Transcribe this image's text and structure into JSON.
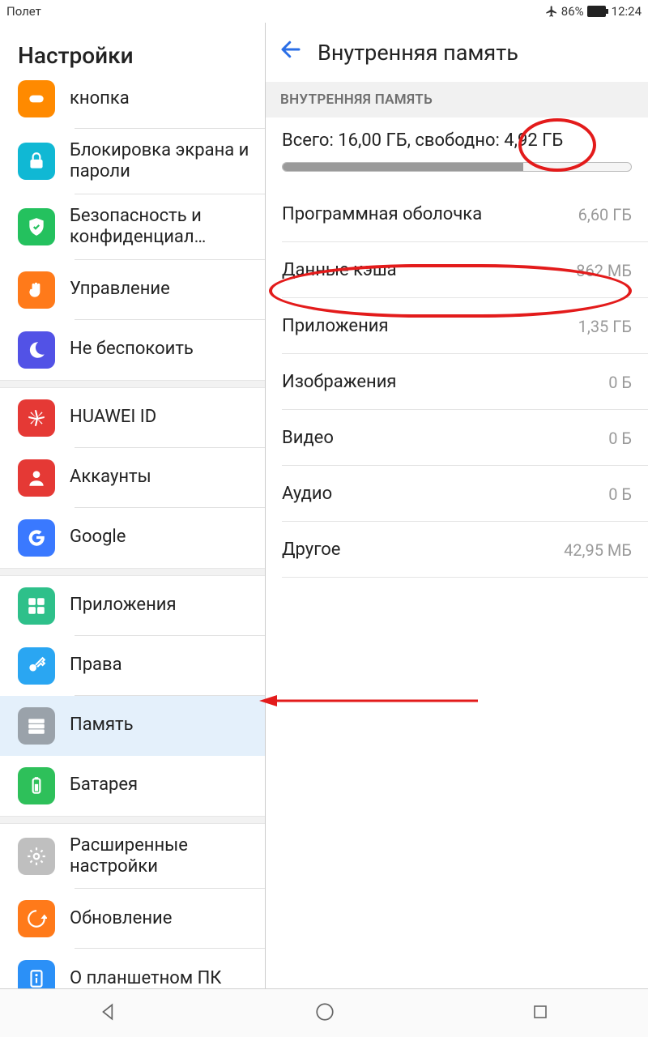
{
  "status": {
    "carrier": "Полет",
    "battery": "86%",
    "time": "12:24"
  },
  "sidebar": {
    "title": "Настройки",
    "items": [
      {
        "label": "кнопка",
        "icon": "button",
        "color": "#ff8a00",
        "twoLine": false,
        "partialTop": true
      },
      {
        "label": "Блокировка экрана и пароли",
        "icon": "lock",
        "color": "#10b8d4",
        "twoLine": true
      },
      {
        "label": "Безопасность и конфиденциал…",
        "icon": "shield",
        "color": "#24c15e",
        "twoLine": true
      },
      {
        "label": "Управление",
        "icon": "hand",
        "color": "#ff7a1a"
      },
      {
        "label": "Не беспокоить",
        "icon": "moon",
        "color": "#5252e6",
        "sepAfter": true
      },
      {
        "label": "HUAWEI ID",
        "icon": "huawei",
        "color": "#e53935"
      },
      {
        "label": "Аккаунты",
        "icon": "account",
        "color": "#e53935"
      },
      {
        "label": "Google",
        "icon": "google",
        "color": "#3a79ff",
        "sepAfter": true
      },
      {
        "label": "Приложения",
        "icon": "apps",
        "color": "#2ec08a"
      },
      {
        "label": "Права",
        "icon": "key",
        "color": "#2aa6f2"
      },
      {
        "label": "Память",
        "icon": "storage",
        "color": "#9aa2aa",
        "selected": true
      },
      {
        "label": "Батарея",
        "icon": "battery",
        "color": "#2ec05a",
        "sepAfter": true
      },
      {
        "label": "Расширенные настройки",
        "icon": "gear",
        "color": "#bfbfbf",
        "twoLine": true
      },
      {
        "label": "Обновление",
        "icon": "update",
        "color": "#ff7a1a"
      },
      {
        "label": "О планшетном ПК",
        "icon": "info",
        "color": "#2b90f7",
        "twoLine": true
      }
    ]
  },
  "content": {
    "title": "Внутренняя память",
    "sectionHeader": "ВНУТРЕННЯЯ ПАМЯТЬ",
    "summary_prefix": "Всего: ",
    "total": "16,00 ГБ",
    "summary_mid": ", свободно: ",
    "free": "4,92 ГБ",
    "usedPercent": 69,
    "rows": [
      {
        "label": "Программная оболочка",
        "value": "6,60 ГБ"
      },
      {
        "label": "Данные кэша",
        "value": "862 МБ"
      },
      {
        "label": "Приложения",
        "value": "1,35 ГБ"
      },
      {
        "label": "Изображения",
        "value": "0 Б"
      },
      {
        "label": "Видео",
        "value": "0 Б"
      },
      {
        "label": "Аудио",
        "value": "0 Б"
      },
      {
        "label": "Другое",
        "value": "42,95 МБ"
      }
    ]
  }
}
